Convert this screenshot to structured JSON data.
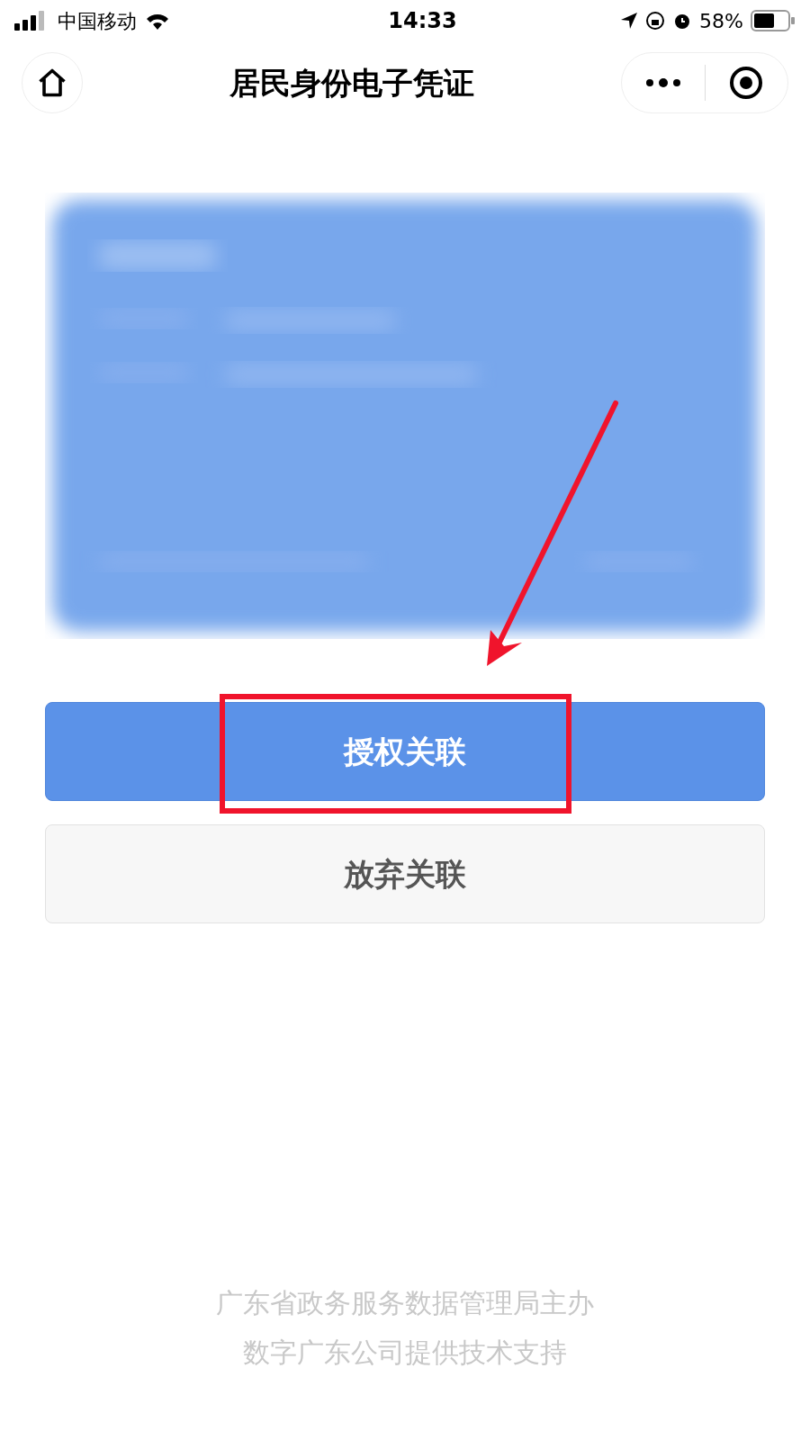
{
  "status_bar": {
    "carrier": "中国移动",
    "time": "14:33",
    "battery": "58%"
  },
  "nav": {
    "title": "居民身份电子凭证"
  },
  "buttons": [
    {
      "label": "授权关联",
      "kind": "primary"
    },
    {
      "label": "放弃关联",
      "kind": "secondary"
    }
  ],
  "footer": [
    "广东省政务服务数据管理局主办",
    "数字广东公司提供技术支持"
  ]
}
